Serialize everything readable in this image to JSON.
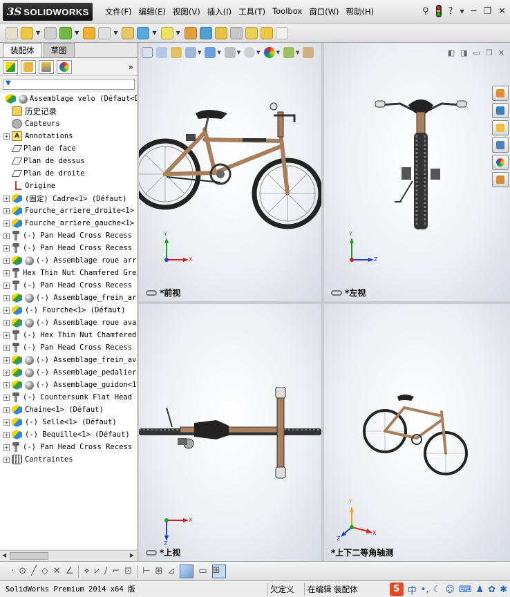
{
  "app": {
    "logo_ds": "3S",
    "logo_text": "SOLIDWORKS",
    "menus": [
      "文件(F)",
      "编辑(E)",
      "视图(V)",
      "插入(I)",
      "工具(T)",
      "Toolbox",
      "窗口(W)",
      "帮助(H)"
    ],
    "help_glyph": "?",
    "minimize": "─",
    "restore": "❐",
    "close": "✕"
  },
  "panel": {
    "tabs": [
      "装配体",
      "草图"
    ],
    "more": "»",
    "filter_glyph": "▼"
  },
  "tree": [
    {
      "label": "Assemblage velo  (Défaut<D",
      "icon": "asm",
      "exp": "none",
      "indent": 0,
      "globe": true
    },
    {
      "label": "历史记录",
      "icon": "hist",
      "exp": "none",
      "indent": 1,
      "cn": true
    },
    {
      "label": "Capteurs",
      "icon": "sensor",
      "exp": "none",
      "indent": 1
    },
    {
      "label": "Annotations",
      "icon": "annot",
      "exp": "plus",
      "indent": 1
    },
    {
      "label": "Plan de face",
      "icon": "plane",
      "exp": "none",
      "indent": 1
    },
    {
      "label": "Plan de dessus",
      "icon": "plane",
      "exp": "none",
      "indent": 1
    },
    {
      "label": "Plan de droite",
      "icon": "plane",
      "exp": "none",
      "indent": 1
    },
    {
      "label": "Origine",
      "icon": "origin",
      "exp": "none",
      "indent": 1
    },
    {
      "label": "(固定) Cadre<1> (Défaut)",
      "icon": "part",
      "exp": "plus",
      "indent": 1
    },
    {
      "label": "Fourche_arriere_droite<1>",
      "icon": "part",
      "exp": "plus",
      "indent": 1
    },
    {
      "label": "Fourche_arriere_gauche<1>",
      "icon": "part",
      "exp": "plus",
      "indent": 1
    },
    {
      "label": "(-) Pan Head Cross Recess",
      "icon": "screw",
      "exp": "plus",
      "indent": 1
    },
    {
      "label": "(-) Pan Head Cross Recess",
      "icon": "screw",
      "exp": "plus",
      "indent": 1
    },
    {
      "label": "(-) Assemblage roue arr",
      "icon": "asm",
      "exp": "plus",
      "indent": 1,
      "globe": true
    },
    {
      "label": "Hex Thin Nut Chamfered Gre",
      "icon": "screw",
      "exp": "plus",
      "indent": 1
    },
    {
      "label": "(-) Pan Head Cross Recess",
      "icon": "screw",
      "exp": "plus",
      "indent": 1
    },
    {
      "label": "(-) Assemblage_frein_ar",
      "icon": "asm",
      "exp": "plus",
      "indent": 1,
      "globe": true
    },
    {
      "label": "(-) Fourche<1> (Défaut)",
      "icon": "part",
      "exp": "plus",
      "indent": 1
    },
    {
      "label": "(-) Assemblage roue ava",
      "icon": "asm",
      "exp": "plus",
      "indent": 1,
      "globe": true
    },
    {
      "label": "(-) Hex Thin Nut Chamfered",
      "icon": "screw",
      "exp": "plus",
      "indent": 1
    },
    {
      "label": "(-) Pan Head Cross Recess",
      "icon": "screw",
      "exp": "plus",
      "indent": 1
    },
    {
      "label": "(-) Assemblage_frein_av",
      "icon": "asm",
      "exp": "plus",
      "indent": 1,
      "globe": true
    },
    {
      "label": "(-) Assemblage_pedalier",
      "icon": "asm",
      "exp": "plus",
      "indent": 1,
      "globe": true
    },
    {
      "label": "(-) Assemblage_guidon<1",
      "icon": "asm",
      "exp": "plus",
      "indent": 1,
      "globe": true
    },
    {
      "label": "(-) Countersunk Flat Head",
      "icon": "screw",
      "exp": "plus",
      "indent": 1
    },
    {
      "label": "Chaine<1> (Défaut)",
      "icon": "part",
      "exp": "plus",
      "indent": 1
    },
    {
      "label": "(-) Selle<1> (Défaut)",
      "icon": "part",
      "exp": "plus",
      "indent": 1
    },
    {
      "label": "(-) Bequille<1> (Défaut)",
      "icon": "part",
      "exp": "plus",
      "indent": 1
    },
    {
      "label": "(-) Pan Head Cross Recess",
      "icon": "screw",
      "exp": "plus",
      "indent": 1
    },
    {
      "label": "Contraintes",
      "icon": "mates",
      "exp": "plus",
      "indent": 1
    }
  ],
  "viewports": {
    "front": {
      "title": "*前视",
      "axis_h": "X",
      "axis_v": "Y"
    },
    "left": {
      "title": "*左视",
      "axis_h": "Z",
      "axis_v": "Y"
    },
    "top": {
      "title": "*上视",
      "axis_h": "X",
      "axis_v": "Z"
    },
    "iso": {
      "title": "*上下二等角轴测",
      "axis_x": "X",
      "axis_y": "Y",
      "axis_z": "Z"
    }
  },
  "status": {
    "product": "SolidWorks Premium 2014 x64 版",
    "underdefined": "欠定义",
    "editing": "在编辑 装配体"
  },
  "ime": {
    "logo": "S",
    "lang": "中"
  },
  "colors": {
    "x_axis": "#d02020",
    "y_axis": "#20a020",
    "z_axis": "#2040d0",
    "bike_frame": "#a87f5c"
  }
}
